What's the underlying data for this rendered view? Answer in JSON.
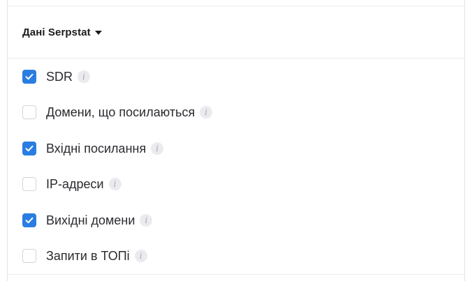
{
  "section": {
    "title": "Дані Serpstat"
  },
  "info_glyph": "i",
  "options": [
    {
      "label": "SDR",
      "checked": true
    },
    {
      "label": "Домени, що посилаються",
      "checked": false
    },
    {
      "label": "Вхідні посилання",
      "checked": true
    },
    {
      "label": "IP-адреси",
      "checked": false
    },
    {
      "label": "Вихідні домени",
      "checked": true
    },
    {
      "label": "Запити в ТОПі",
      "checked": false
    }
  ],
  "colors": {
    "checkbox_checked": "#2a7de1",
    "checkbox_border": "#d4d4dc",
    "text": "#2b2b30"
  }
}
